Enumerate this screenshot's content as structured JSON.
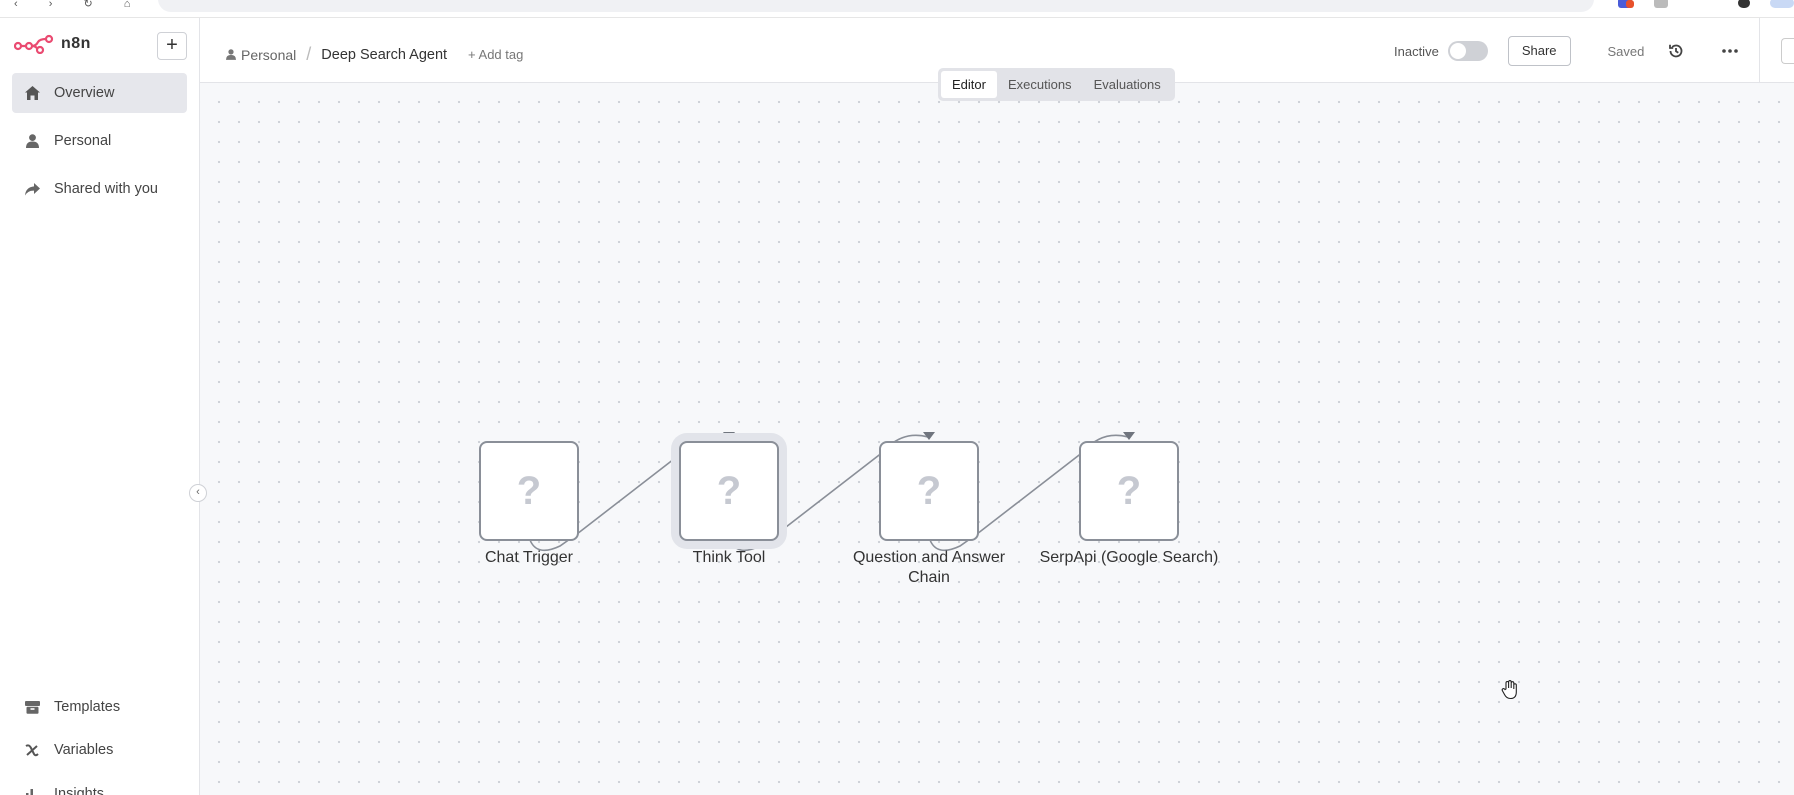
{
  "app": {
    "name": "n8n"
  },
  "sidebar": {
    "add_label": "+",
    "items": [
      {
        "label": "Overview",
        "icon": "home-icon",
        "active": true
      },
      {
        "label": "Personal",
        "icon": "user-icon"
      },
      {
        "label": "Shared with you",
        "icon": "share-icon"
      }
    ],
    "bottom": [
      {
        "label": "Templates",
        "icon": "box-icon"
      },
      {
        "label": "Variables",
        "icon": "variable-icon"
      },
      {
        "label": "Insights",
        "icon": "chart-icon"
      }
    ]
  },
  "header": {
    "breadcrumb_project": "Personal",
    "breadcrumb_sep": "/",
    "workflow_name": "Deep Search Agent",
    "add_tag": "+ Add tag",
    "status_label": "Inactive",
    "share_label": "Share",
    "saved_label": "Saved"
  },
  "tabs": [
    {
      "label": "Editor",
      "active": true
    },
    {
      "label": "Executions"
    },
    {
      "label": "Evaluations"
    }
  ],
  "nodes": [
    {
      "label": "Chat Trigger",
      "placeholder": "?"
    },
    {
      "label": "Think Tool",
      "placeholder": "?",
      "selected": true
    },
    {
      "label": "Question and Answer Chain",
      "placeholder": "?"
    },
    {
      "label": "SerpApi (Google Search)",
      "placeholder": "?"
    }
  ],
  "colors": {
    "brand": "#ea4b71",
    "edge": "#8a8f98"
  }
}
